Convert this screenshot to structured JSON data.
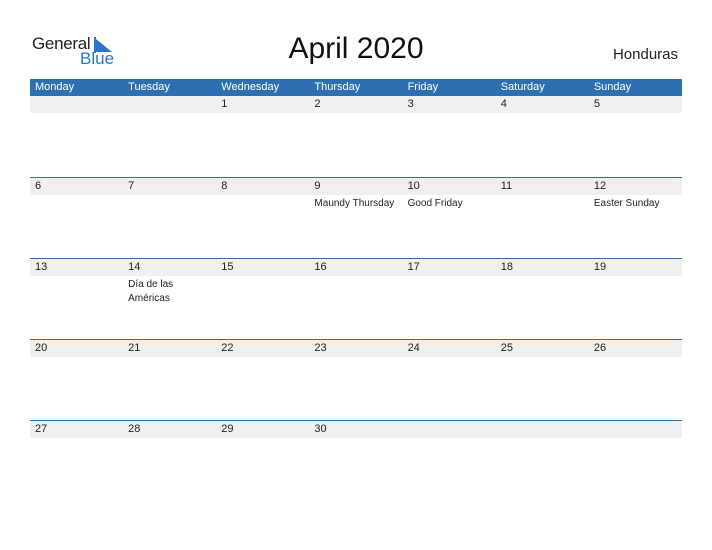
{
  "logo": {
    "line1": "General",
    "line2": "Blue",
    "accent": "#2a77c7"
  },
  "title": "April 2020",
  "country": "Honduras",
  "colors": {
    "header_bg": "#2e6fb0",
    "date_band": "#f0f0f0"
  },
  "weekdays": [
    "Monday",
    "Tuesday",
    "Wednesday",
    "Thursday",
    "Friday",
    "Saturday",
    "Sunday"
  ],
  "weeks": [
    [
      {
        "day": "",
        "holiday": ""
      },
      {
        "day": "",
        "holiday": ""
      },
      {
        "day": "1",
        "holiday": ""
      },
      {
        "day": "2",
        "holiday": ""
      },
      {
        "day": "3",
        "holiday": ""
      },
      {
        "day": "4",
        "holiday": ""
      },
      {
        "day": "5",
        "holiday": ""
      }
    ],
    [
      {
        "day": "6",
        "holiday": ""
      },
      {
        "day": "7",
        "holiday": ""
      },
      {
        "day": "8",
        "holiday": ""
      },
      {
        "day": "9",
        "holiday": "Maundy Thursday"
      },
      {
        "day": "10",
        "holiday": "Good Friday"
      },
      {
        "day": "11",
        "holiday": ""
      },
      {
        "day": "12",
        "holiday": "Easter Sunday"
      }
    ],
    [
      {
        "day": "13",
        "holiday": ""
      },
      {
        "day": "14",
        "holiday": "Día de las Américas"
      },
      {
        "day": "15",
        "holiday": ""
      },
      {
        "day": "16",
        "holiday": ""
      },
      {
        "day": "17",
        "holiday": ""
      },
      {
        "day": "18",
        "holiday": ""
      },
      {
        "day": "19",
        "holiday": ""
      }
    ],
    [
      {
        "day": "20",
        "holiday": ""
      },
      {
        "day": "21",
        "holiday": ""
      },
      {
        "day": "22",
        "holiday": ""
      },
      {
        "day": "23",
        "holiday": ""
      },
      {
        "day": "24",
        "holiday": ""
      },
      {
        "day": "25",
        "holiday": ""
      },
      {
        "day": "26",
        "holiday": ""
      }
    ],
    [
      {
        "day": "27",
        "holiday": ""
      },
      {
        "day": "28",
        "holiday": ""
      },
      {
        "day": "29",
        "holiday": ""
      },
      {
        "day": "30",
        "holiday": ""
      },
      {
        "day": "",
        "holiday": ""
      },
      {
        "day": "",
        "holiday": ""
      },
      {
        "day": "",
        "holiday": ""
      }
    ]
  ]
}
